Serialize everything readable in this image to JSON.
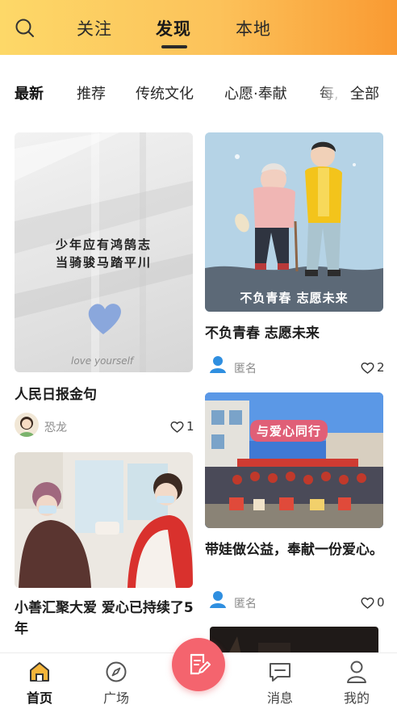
{
  "header": {
    "tabs": [
      {
        "label": "关注",
        "active": false
      },
      {
        "label": "发现",
        "active": true
      },
      {
        "label": "本地",
        "active": false
      }
    ]
  },
  "categories": {
    "items": [
      "最新",
      "推荐",
      "传统文化",
      "心愿·奉献",
      "每,"
    ],
    "all_label": "全部",
    "active_index": 0
  },
  "feed": [
    {
      "image_caption_line1": "少年应有鸿鹄志",
      "image_caption_line2": "当骑骏马踏平川",
      "image_footer": "love yourself",
      "title": "人民日报金句",
      "author": "恐龙",
      "likes": "1"
    },
    {
      "image_banner": "不负青春 志愿未来",
      "title": "不负青春 志愿未来",
      "author": "匿名",
      "likes": "2"
    },
    {
      "title": "小善汇聚大爱 爱心已持续了5年",
      "author": "",
      "likes": ""
    },
    {
      "image_banner": "与爱心同行",
      "title": "带娃做公益，奉献一份爱心。",
      "author": "匿名",
      "likes": "0"
    }
  ],
  "bottom_nav": {
    "items": [
      {
        "label": "首页",
        "icon": "home-icon",
        "active": true
      },
      {
        "label": "广场",
        "icon": "compass-icon",
        "active": false
      },
      {
        "label": "",
        "icon": "edit-icon",
        "active": false
      },
      {
        "label": "消息",
        "icon": "message-icon",
        "active": false
      },
      {
        "label": "我的",
        "icon": "user-icon",
        "active": false
      }
    ]
  },
  "colors": {
    "header_start": "#fdd868",
    "header_end": "#f99a32",
    "post_button": "#f4646e",
    "poster_bg": "#b5d3e6",
    "volunteer_vest": "#f3c41b"
  }
}
